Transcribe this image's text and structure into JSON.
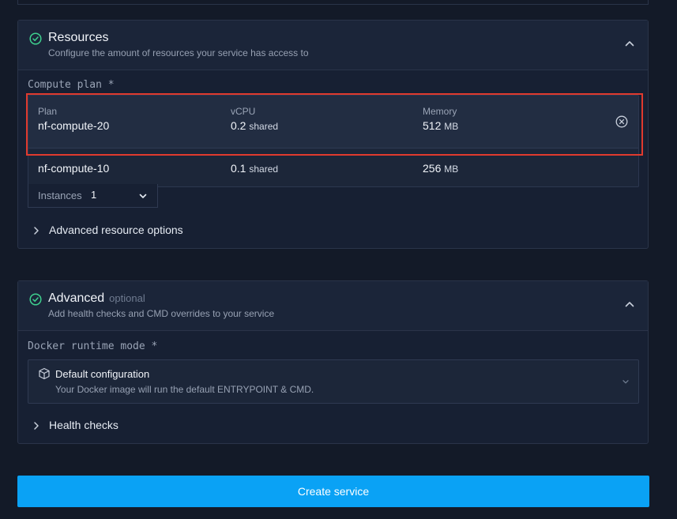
{
  "resources": {
    "title": "Resources",
    "subtitle": "Configure the amount of resources your service has access to",
    "compute_plan_label": "Compute plan *",
    "columns": {
      "plan": "Plan",
      "vcpu": "vCPU",
      "memory": "Memory"
    },
    "selected_plan": {
      "name": "nf-compute-20",
      "vcpu": "0.2",
      "vcpu_unit": "shared",
      "memory": "512",
      "memory_unit": "MB"
    },
    "option_plan": {
      "name": "nf-compute-10",
      "vcpu": "0.1",
      "vcpu_unit": "shared",
      "memory": "256",
      "memory_unit": "MB"
    },
    "instances_label": "Instances",
    "instances_value": "1",
    "advanced_options_label": "Advanced resource options"
  },
  "advanced": {
    "title": "Advanced",
    "optional_label": "optional",
    "subtitle": "Add health checks and CMD overrides to your service",
    "docker_mode_label": "Docker runtime mode *",
    "docker_option_title": "Default configuration",
    "docker_option_sub": "Your Docker image will run the default ENTRYPOINT & CMD.",
    "health_checks_label": "Health checks"
  },
  "create_button_label": "Create service",
  "colors": {
    "accent": "#0aa2f5",
    "success": "#3ecf8e",
    "highlight": "#e03a2e"
  }
}
